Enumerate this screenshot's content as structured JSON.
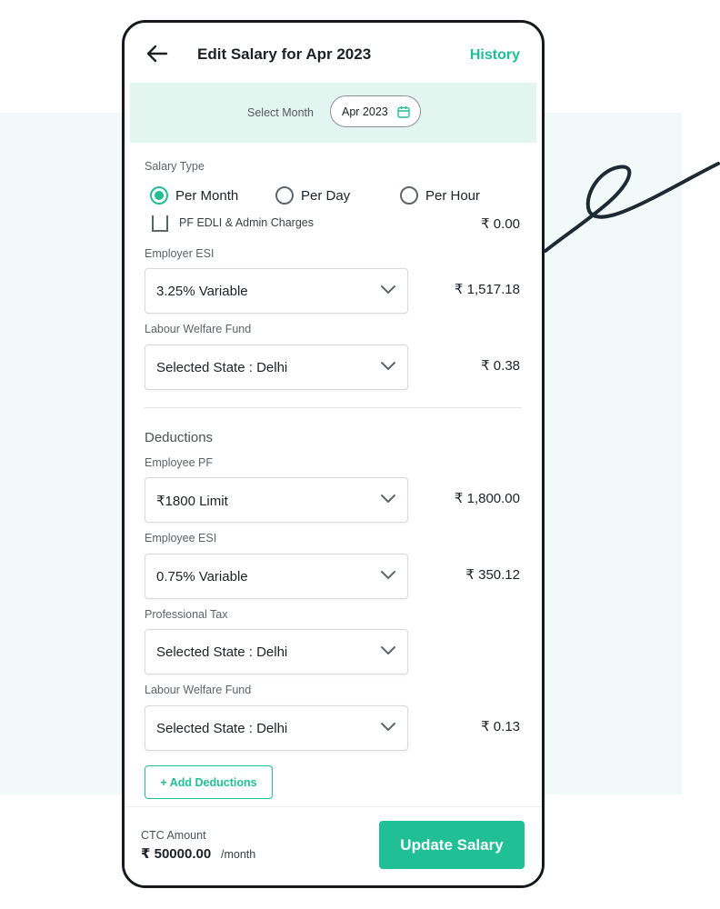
{
  "header": {
    "title": "Edit Salary for Apr 2023",
    "history_label": "History",
    "back_icon": "arrow-left-icon"
  },
  "month": {
    "label": "Select Month",
    "value": "Apr 2023",
    "icon": "calendar-icon"
  },
  "salary_type": {
    "label": "Salary Type",
    "options": [
      "Per Month",
      "Per Day",
      "Per Hour"
    ],
    "selected": "Per Month"
  },
  "pf_edli": {
    "label": "PF EDLI & Admin Charges",
    "checked": false,
    "amount": "₹ 0.00"
  },
  "employer": {
    "esi": {
      "label": "Employer ESI",
      "value": "3.25% Variable",
      "amount": "₹ 1,517.18"
    },
    "lwf": {
      "label": "Labour Welfare Fund",
      "value": "Selected State : Delhi",
      "amount": "₹ 0.38"
    }
  },
  "deductions": {
    "title": "Deductions",
    "pf": {
      "label": "Employee PF",
      "value": "₹1800 Limit",
      "amount": "₹ 1,800.00"
    },
    "esi": {
      "label": "Employee ESI",
      "value": "0.75% Variable",
      "amount": "₹ 350.12"
    },
    "pt": {
      "label": "Professional Tax",
      "value": "Selected State : Delhi",
      "amount": ""
    },
    "lwf": {
      "label": "Labour Welfare Fund",
      "value": "Selected State : Delhi",
      "amount": "₹ 0.13"
    },
    "add_label": "+ Add Deductions"
  },
  "footer": {
    "ctc_label": "CTC Amount",
    "ctc_value": "₹ 50000.00",
    "ctc_unit": "/month",
    "update_label": "Update Salary"
  },
  "colors": {
    "accent": "#20bf95",
    "accent_light": "#e3f5ef",
    "background_band": "#f2f9f9",
    "text": "#1d2125"
  }
}
